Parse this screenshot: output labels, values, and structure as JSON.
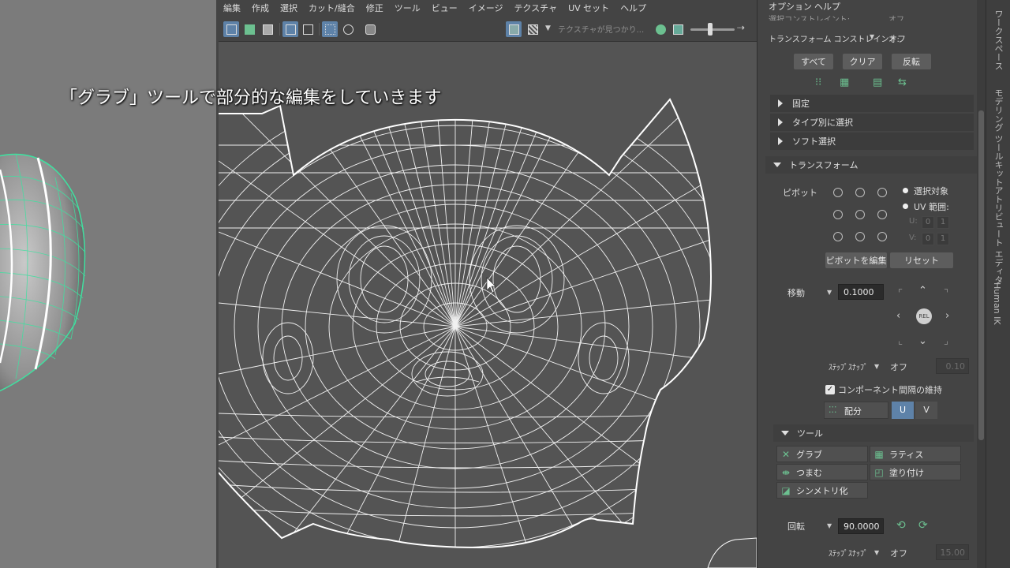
{
  "menu": [
    "編集",
    "作成",
    "選択",
    "カット/縫合",
    "修正",
    "ツール",
    "ビュー",
    "イメージ",
    "テクスチャ",
    "UV セット",
    "ヘルプ"
  ],
  "toolbar": {
    "texture_search": "テクスチャが見つかり..."
  },
  "subtitle": "「グラブ」ツールで部分的な編集をしていきます",
  "panel": {
    "top_menu": [
      "オプション",
      "ヘルプ"
    ],
    "top_partial": {
      "label": "選択コンストレイント:",
      "value": "オフ"
    },
    "transform_constraint": {
      "label": "トランスフォーム コンストレイント:",
      "value": "オフ"
    },
    "select_buttons": [
      "すべて",
      "クリア",
      "反転"
    ],
    "sections": {
      "fix": "固定",
      "by_type": "タイプ別に選択",
      "soft": "ソフト選択",
      "transform": "トランスフォーム",
      "tools": "ツール"
    },
    "pivot": {
      "label": "ピボット",
      "option_selected": "選択対象",
      "option_uv_range": "UV 範囲:",
      "u_label": "U:",
      "v_label": "V:",
      "u_values": [
        "0",
        "1"
      ],
      "v_values": [
        "0",
        "1"
      ],
      "edit_button": "ピボットを編集",
      "reset_button": "リセット"
    },
    "move": {
      "label": "移動",
      "value": "0.1000",
      "rel": "REL",
      "step_snap_label": "ｽﾃｯﾌﾟｽﾅｯﾌﾟ",
      "step_snap_value": "オフ",
      "step_snap_num": "0.10"
    },
    "keep_spacing": {
      "label": "コンポーネント間隔の維持",
      "checked": true
    },
    "distribute": {
      "label": "配分",
      "u": "U",
      "v": "V"
    },
    "tools": {
      "grab": "グラブ",
      "lattice": "ラティス",
      "pinch": "つまむ",
      "paint": "塗り付け",
      "symmetrize": "シンメトリ化"
    },
    "rotate": {
      "label": "回転",
      "value": "90.0000",
      "step_snap_label": "ｽﾃｯﾌﾟｽﾅｯﾌﾟ",
      "step_snap_value": "オフ",
      "step_snap_num": "15.00"
    }
  },
  "side_tabs": [
    "ワークスペース",
    "モデリング ツールキット",
    "アトリビュート エディタ",
    "Human IK"
  ],
  "colors": {
    "accent": "#5e82a8",
    "wire": "#ffffff",
    "mesh_wire": "#40e0a0",
    "panel_bg": "#444444",
    "uv_bg": "#545454"
  }
}
